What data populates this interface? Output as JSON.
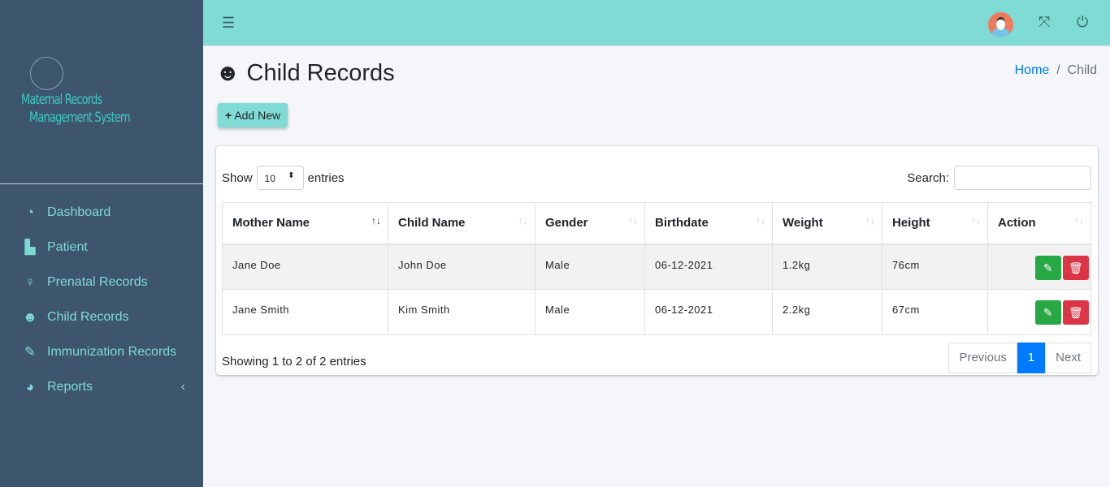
{
  "sidebar": {
    "logo_line1": "Maternal Records",
    "logo_line2": "Management System",
    "items": [
      {
        "label": "Dashboard",
        "icon": "tachometer-icon"
      },
      {
        "label": "Patient",
        "icon": "hospital-user-icon"
      },
      {
        "label": "Prenatal Records",
        "icon": "female-icon"
      },
      {
        "label": "Child Records",
        "icon": "baby-icon"
      },
      {
        "label": "Immunization Records",
        "icon": "syringe-icon"
      },
      {
        "label": "Reports",
        "icon": "chart-pie-icon"
      }
    ]
  },
  "topbar": {
    "menu_icon": "☰",
    "fullscreen_icon": "⤧",
    "power_icon": "⏻"
  },
  "page": {
    "title": "Child Records",
    "breadcrumb_home": "Home",
    "breadcrumb_sep": "/",
    "breadcrumb_current": "Child",
    "add_label": "Add New"
  },
  "table": {
    "show": "Show",
    "page_size": "10",
    "entries": "entries",
    "search_label": "Search:",
    "headers": [
      "Mother Name",
      "Child Name",
      "Gender",
      "Birthdate",
      "Weight",
      "Height",
      "Action"
    ],
    "rows": [
      [
        "Jane Doe",
        "John Doe",
        "Male",
        "06-12-2021",
        "1.2kg",
        "76cm"
      ],
      [
        "Jane Smith",
        "Kim Smith",
        "Male",
        "06-12-2021",
        "2.2kg",
        "67cm"
      ]
    ],
    "info": "Showing 1 to 2 of 2 entries",
    "prev": "Previous",
    "page": "1",
    "next": "Next"
  },
  "colors": {
    "sidebar": "#3d566e",
    "topbar": "#7fdbd4",
    "accent": "#007bff",
    "edit": "#28a745",
    "delete": "#dc3545"
  }
}
